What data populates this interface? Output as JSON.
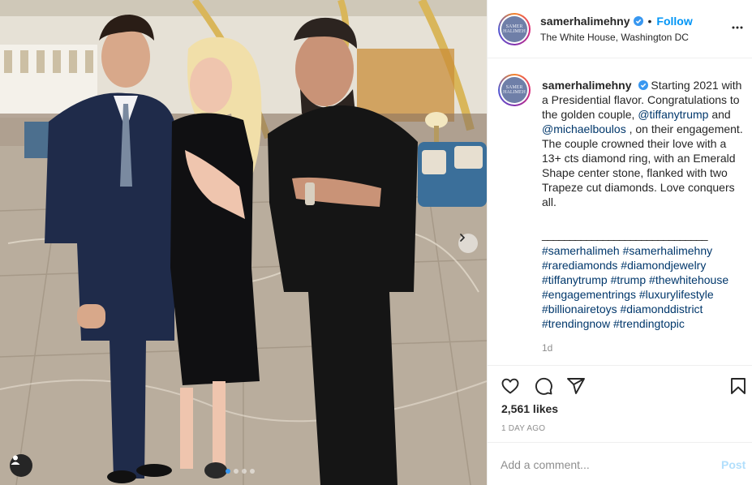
{
  "post": {
    "username": "samerhalimehny",
    "follow_label": "Follow",
    "separator": "•",
    "location": "The White House, Washington DC",
    "avatar_text": "SAMER HALIMEH",
    "caption": {
      "text_1": "Starting 2021 with a Presidential flavor. Congratulations to the golden couple, ",
      "mention_1": "@tiffanytrump",
      "text_2": " and ",
      "mention_2": "@michaelboulos",
      "text_3": " , on their engagement. The couple crowned their love with a 13+ cts diamond ring, with an Emerald Shape center stone, flanked with two Trapeze cut diamonds. Love conquers all.",
      "divider": "______________________________",
      "hashtags": [
        "#samerhalimeh",
        "#samerhalimehny",
        "#rarediamonds",
        "#diamondjewelry",
        "#tiffanytrump",
        "#trump",
        "#thewhitehouse",
        "#engagementrings",
        "#luxurylifestyle",
        "#billionairetoys",
        "#diamonddistrict",
        "#trendingnow",
        "#trendingtopic"
      ],
      "time": "1d"
    },
    "likes": "2,561 likes",
    "time_ago": "1 DAY AGO",
    "comment_placeholder": "Add a comment...",
    "post_label": "Post"
  },
  "icons": {
    "like": "heart-icon",
    "comment": "comment-icon",
    "share": "send-icon",
    "save": "bookmark-icon",
    "more": "more-icon",
    "verified": "verified-badge-icon",
    "next": "chevron-right-icon",
    "tags": "user-tag-icon"
  },
  "colors": {
    "link": "#00376b",
    "follow": "#0095f6",
    "verified": "#3897f0",
    "post_disabled": "#b2dffc",
    "muted": "#8e8e8e"
  },
  "carousel": {
    "slides": 4,
    "active": 1
  }
}
